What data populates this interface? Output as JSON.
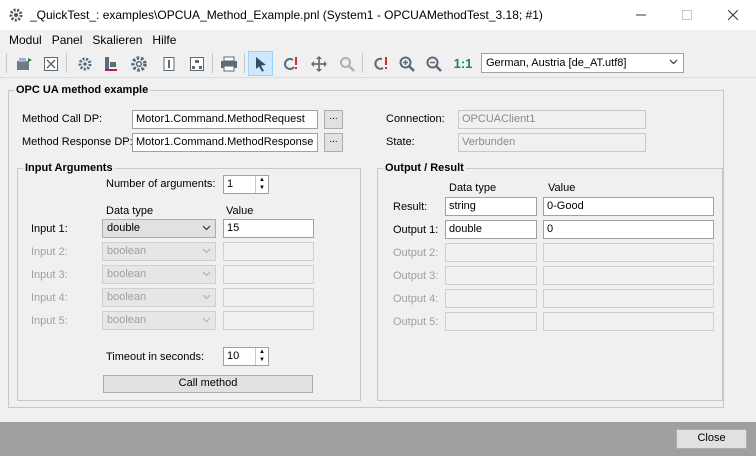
{
  "window": {
    "title": "_QuickTest_: examples\\OPCUA_Method_Example.pnl (System1 - OPCUAMethodTest_3.18; #1)"
  },
  "menu": [
    "Modul",
    "Panel",
    "Skalieren",
    "Hilfe"
  ],
  "toolbar": {
    "zoom_reset_label": "1:1",
    "language_value": "German, Austria [de_AT.utf8]"
  },
  "panel": {
    "title": "OPC UA method example",
    "method_call_label": "Method Call DP:",
    "method_call_value": "Motor1.Command.MethodRequest",
    "method_response_label": "Method Response DP:",
    "method_response_value": "Motor1.Command.MethodResponse",
    "browse_label": "...",
    "connection_label": "Connection:",
    "connection_value": "OPCUAClient1",
    "state_label": "State:",
    "state_value": "Verbunden"
  },
  "input_group": {
    "title": "Input Arguments",
    "num_args_label": "Number of arguments:",
    "num_args_value": "1",
    "col_datatype": "Data type",
    "col_value": "Value",
    "rows": [
      {
        "label": "Input 1:",
        "type": "double",
        "value": "15"
      },
      {
        "label": "Input 2:",
        "type": "boolean",
        "value": ""
      },
      {
        "label": "Input 3:",
        "type": "boolean",
        "value": ""
      },
      {
        "label": "Input 4:",
        "type": "boolean",
        "value": ""
      },
      {
        "label": "Input 5:",
        "type": "boolean",
        "value": ""
      }
    ],
    "timeout_label": "Timeout in seconds:",
    "timeout_value": "10",
    "call_button": "Call method"
  },
  "output_group": {
    "title": "Output / Result",
    "col_datatype": "Data type",
    "col_value": "Value",
    "result_label": "Result:",
    "result_type": "string",
    "result_value": "0-Good",
    "rows": [
      {
        "label": "Output 1:",
        "type": "double",
        "value": "0"
      },
      {
        "label": "Output 2:",
        "type": "",
        "value": ""
      },
      {
        "label": "Output 3:",
        "type": "",
        "value": ""
      },
      {
        "label": "Output 4:",
        "type": "",
        "value": ""
      },
      {
        "label": "Output 5:",
        "type": "",
        "value": ""
      }
    ]
  },
  "footer": {
    "close_button": "Close"
  }
}
